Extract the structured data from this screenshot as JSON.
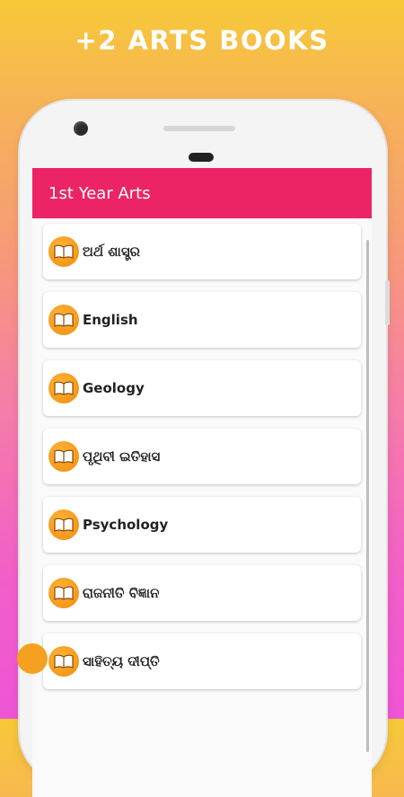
{
  "promo": {
    "title": "+2 ARTS BOOKS"
  },
  "app": {
    "title": "1st Year Arts"
  },
  "books": [
    {
      "label": "ଅର୍ଥ  ଶାସ୍ତ୍ର",
      "icon": "book-icon"
    },
    {
      "label": "English",
      "icon": "book-icon"
    },
    {
      "label": "Geology",
      "icon": "book-icon"
    },
    {
      "label": " ପୃଥିବୀ ଇତିହାସ",
      "icon": "book-icon"
    },
    {
      "label": "Psychology",
      "icon": "book-icon"
    },
    {
      "label": "ରାଜନୀତି ବିଜ୍ଞାନ",
      "icon": "book-icon"
    },
    {
      "label": "ସାହିତ୍ୟ ଦୀପ୍ତି",
      "icon": "book-icon"
    }
  ],
  "colors": {
    "appbar": "#ec2466",
    "icon": "#f5a020"
  }
}
